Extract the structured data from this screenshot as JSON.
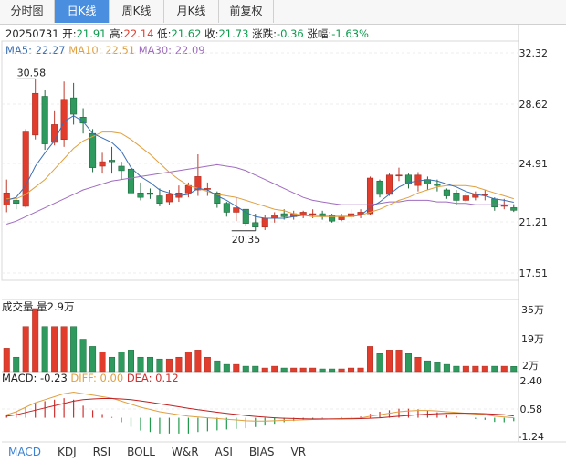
{
  "tabs": [
    "分时图",
    "日K线",
    "周K线",
    "月K线",
    "前复权"
  ],
  "active_tab": 1,
  "quote": {
    "date": "20250731",
    "open_label": "开:",
    "open": "21.91",
    "high_label": "高:",
    "high": "22.14",
    "low_label": "低:",
    "low": "21.62",
    "close_label": "收:",
    "close": "21.73",
    "change_label": "涨跌:",
    "change": "-0.36",
    "pct_label": "涨幅:",
    "pct": "-1.63%"
  },
  "ma": {
    "ma5": "MA5: 22.27",
    "ma10": "MA10: 22.51",
    "ma30": "MA30: 22.09"
  },
  "price_axis": [
    "32.32",
    "28.62",
    "24.91",
    "21.21",
    "17.51"
  ],
  "max_label": "30.58",
  "min_label": "20.35",
  "volume": {
    "label": "成交量 量2.9万",
    "axis": [
      "35万",
      "19万",
      "2万"
    ]
  },
  "macd": {
    "macd": "MACD: -0.23",
    "diff": "DIFF: 0.00",
    "dea": "DEA: 0.12",
    "axis": [
      "2.40",
      "0.58",
      "-1.24"
    ]
  },
  "bottom_tabs": [
    "MACD",
    "KDJ",
    "RSI",
    "BOLL",
    "W&R",
    "ASI",
    "BIAS",
    "VR"
  ],
  "active_bottom_tab": 0,
  "colors": {
    "up": "#e23c2c",
    "down": "#2e9a5e",
    "ma5": "#3b6fb6",
    "ma10": "#e0a040",
    "ma30": "#a06cc0",
    "accent": "#4a8ee0"
  },
  "chart_data": {
    "type": "candlestick",
    "ylim": [
      17.51,
      32.32
    ],
    "candles": [
      [
        22.1,
        22.9,
        23.8,
        21.6
      ],
      [
        22.4,
        22.2,
        22.6,
        21.8
      ],
      [
        22.0,
        27.0,
        27.2,
        21.9
      ],
      [
        26.8,
        29.6,
        30.58,
        26.5
      ],
      [
        29.4,
        26.2,
        29.8,
        25.8
      ],
      [
        26.3,
        27.5,
        28.4,
        26.1
      ],
      [
        26.5,
        29.2,
        30.4,
        26.0
      ],
      [
        29.3,
        28.2,
        30.3,
        27.5
      ],
      [
        28.0,
        27.6,
        28.6,
        26.9
      ],
      [
        26.9,
        24.6,
        27.2,
        24.3
      ],
      [
        24.7,
        25.0,
        25.6,
        24.2
      ],
      [
        25.1,
        25.0,
        26.0,
        24.2
      ],
      [
        24.7,
        24.4,
        25.0,
        23.8
      ],
      [
        24.5,
        22.9,
        24.8,
        22.8
      ],
      [
        22.9,
        22.6,
        23.6,
        22.4
      ],
      [
        22.9,
        22.8,
        23.2,
        22.5
      ],
      [
        22.7,
        22.2,
        23.2,
        22.0
      ],
      [
        22.3,
        22.8,
        23.1,
        22.1
      ],
      [
        22.6,
        22.9,
        23.4,
        22.3
      ],
      [
        22.9,
        23.4,
        23.6,
        22.6
      ],
      [
        23.1,
        24.0,
        25.5,
        22.7
      ],
      [
        23.2,
        23.2,
        23.6,
        22.7
      ],
      [
        22.9,
        22.2,
        23.0,
        21.9
      ],
      [
        22.2,
        21.6,
        22.3,
        21.3
      ],
      [
        21.6,
        21.9,
        22.6,
        21.0
      ],
      [
        21.8,
        20.85,
        21.8,
        20.7
      ],
      [
        20.9,
        20.6,
        21.5,
        20.35
      ],
      [
        20.6,
        21.2,
        21.4,
        20.4
      ],
      [
        21.2,
        21.4,
        21.6,
        20.9
      ],
      [
        21.5,
        21.3,
        21.8,
        21.1
      ],
      [
        21.3,
        21.5,
        21.7,
        21.1
      ],
      [
        21.4,
        21.6,
        21.7,
        21.2
      ],
      [
        21.5,
        21.5,
        21.8,
        21.2
      ],
      [
        21.5,
        21.3,
        21.7,
        21.1
      ],
      [
        21.4,
        21.0,
        21.5,
        20.9
      ],
      [
        21.1,
        21.3,
        21.5,
        21.0
      ],
      [
        21.3,
        21.5,
        21.8,
        21.1
      ],
      [
        21.4,
        21.6,
        21.8,
        21.2
      ],
      [
        21.5,
        23.9,
        24.0,
        21.4
      ],
      [
        23.7,
        22.8,
        23.8,
        22.6
      ],
      [
        22.8,
        24.1,
        24.2,
        22.7
      ],
      [
        24.1,
        24.1,
        24.6,
        23.7
      ],
      [
        24.1,
        23.5,
        24.2,
        23.2
      ],
      [
        23.4,
        24.1,
        24.3,
        23.0
      ],
      [
        23.8,
        23.5,
        24.0,
        23.1
      ],
      [
        23.5,
        23.4,
        23.8,
        23.0
      ],
      [
        23.1,
        22.7,
        23.2,
        22.5
      ],
      [
        22.9,
        22.4,
        23.1,
        22.1
      ],
      [
        22.4,
        22.7,
        22.9,
        22.3
      ],
      [
        22.6,
        22.8,
        23.0,
        22.4
      ],
      [
        22.8,
        22.8,
        23.1,
        22.4
      ],
      [
        22.5,
        21.95,
        22.6,
        21.7
      ],
      [
        22.0,
        22.1,
        22.5,
        21.8
      ],
      [
        21.91,
        21.73,
        22.14,
        21.62
      ]
    ],
    "ma5": [
      22.4,
      22.6,
      23.4,
      24.7,
      25.6,
      26.4,
      27.7,
      28.1,
      27.7,
      26.9,
      26.6,
      26.3,
      25.7,
      24.6,
      24.0,
      23.6,
      23.1,
      22.9,
      22.7,
      22.8,
      23.2,
      23.1,
      22.7,
      22.4,
      22.0,
      21.6,
      21.3,
      21.2,
      21.2,
      21.2,
      21.3,
      21.4,
      21.4,
      21.4,
      21.4,
      21.4,
      21.4,
      21.4,
      21.9,
      22.3,
      22.8,
      23.3,
      23.6,
      23.7,
      23.8,
      23.7,
      23.5,
      23.3,
      23.0,
      22.8,
      22.7,
      22.5,
      22.4,
      22.27
    ],
    "ma10": [
      22.5,
      22.5,
      22.8,
      23.3,
      23.8,
      24.5,
      25.2,
      25.9,
      26.4,
      26.7,
      27.0,
      27.0,
      26.9,
      26.5,
      26.0,
      25.5,
      24.9,
      24.3,
      23.8,
      23.4,
      23.2,
      23.0,
      22.8,
      22.7,
      22.6,
      22.4,
      22.2,
      22.0,
      21.8,
      21.7,
      21.5,
      21.4,
      21.3,
      21.3,
      21.3,
      21.3,
      21.3,
      21.4,
      21.6,
      21.8,
      22.1,
      22.4,
      22.6,
      22.9,
      23.1,
      23.3,
      23.4,
      23.4,
      23.4,
      23.3,
      23.1,
      22.9,
      22.7,
      22.51
    ],
    "ma30": [
      20.8,
      21.0,
      21.3,
      21.6,
      21.9,
      22.2,
      22.5,
      22.8,
      23.1,
      23.3,
      23.5,
      23.7,
      23.8,
      23.9,
      24.0,
      24.1,
      24.2,
      24.3,
      24.4,
      24.5,
      24.6,
      24.7,
      24.8,
      24.7,
      24.6,
      24.4,
      24.1,
      23.8,
      23.5,
      23.2,
      22.9,
      22.6,
      22.4,
      22.3,
      22.2,
      22.1,
      22.1,
      22.1,
      22.1,
      22.2,
      22.3,
      22.3,
      22.4,
      22.4,
      22.4,
      22.3,
      22.3,
      22.2,
      22.2,
      22.1,
      22.1,
      22.1,
      22.1,
      22.09
    ],
    "volume_ylim": [
      0,
      35
    ],
    "volumes": [
      13,
      8,
      25,
      35,
      25,
      25,
      25,
      25,
      18,
      14,
      11,
      8,
      11,
      12,
      8,
      8,
      7,
      7,
      8,
      11,
      12,
      8,
      6,
      4,
      4,
      3,
      3,
      2,
      3,
      2,
      2,
      2,
      2,
      1.5,
      1.5,
      1.5,
      2,
      2,
      14,
      10,
      12,
      12,
      10,
      8,
      6,
      5,
      4,
      3,
      3,
      3,
      3,
      3,
      3,
      2.9
    ],
    "macd_ylim": [
      -1.24,
      2.4
    ],
    "diff": [
      0.2,
      0.4,
      0.7,
      1.0,
      1.2,
      1.4,
      1.6,
      1.7,
      1.6,
      1.5,
      1.4,
      1.3,
      1.1,
      0.9,
      0.7,
      0.55,
      0.4,
      0.3,
      0.2,
      0.1,
      0.05,
      0.0,
      -0.05,
      -0.1,
      -0.15,
      -0.2,
      -0.22,
      -0.22,
      -0.2,
      -0.18,
      -0.16,
      -0.14,
      -0.12,
      -0.1,
      -0.08,
      -0.06,
      -0.04,
      -0.02,
      0.1,
      0.2,
      0.3,
      0.4,
      0.45,
      0.48,
      0.48,
      0.45,
      0.4,
      0.35,
      0.3,
      0.25,
      0.2,
      0.1,
      0.05,
      0.0
    ],
    "dea": [
      0.1,
      0.2,
      0.35,
      0.5,
      0.65,
      0.8,
      0.95,
      1.1,
      1.2,
      1.25,
      1.28,
      1.28,
      1.25,
      1.2,
      1.12,
      1.03,
      0.93,
      0.83,
      0.73,
      0.63,
      0.53,
      0.45,
      0.37,
      0.29,
      0.22,
      0.15,
      0.09,
      0.04,
      0.0,
      -0.03,
      -0.05,
      -0.07,
      -0.08,
      -0.08,
      -0.08,
      -0.08,
      -0.07,
      -0.06,
      -0.03,
      0.0,
      0.05,
      0.1,
      0.15,
      0.2,
      0.24,
      0.27,
      0.29,
      0.3,
      0.3,
      0.29,
      0.27,
      0.24,
      0.2,
      0.12
    ],
    "macd_hist": [
      0.2,
      0.4,
      0.7,
      1.0,
      1.1,
      1.2,
      1.3,
      1.2,
      0.8,
      0.5,
      0.25,
      0.05,
      -0.3,
      -0.6,
      -0.85,
      -0.95,
      -1.05,
      -1.05,
      -1.05,
      -1.05,
      -0.95,
      -0.9,
      -0.84,
      -0.78,
      -0.74,
      -0.7,
      -0.62,
      -0.52,
      -0.4,
      -0.3,
      -0.22,
      -0.14,
      -0.08,
      -0.04,
      0.0,
      0.04,
      0.06,
      0.08,
      0.26,
      0.4,
      0.5,
      0.6,
      0.6,
      0.56,
      0.48,
      0.36,
      0.22,
      0.1,
      0.0,
      -0.08,
      -0.14,
      -0.28,
      -0.3,
      -0.23
    ]
  }
}
